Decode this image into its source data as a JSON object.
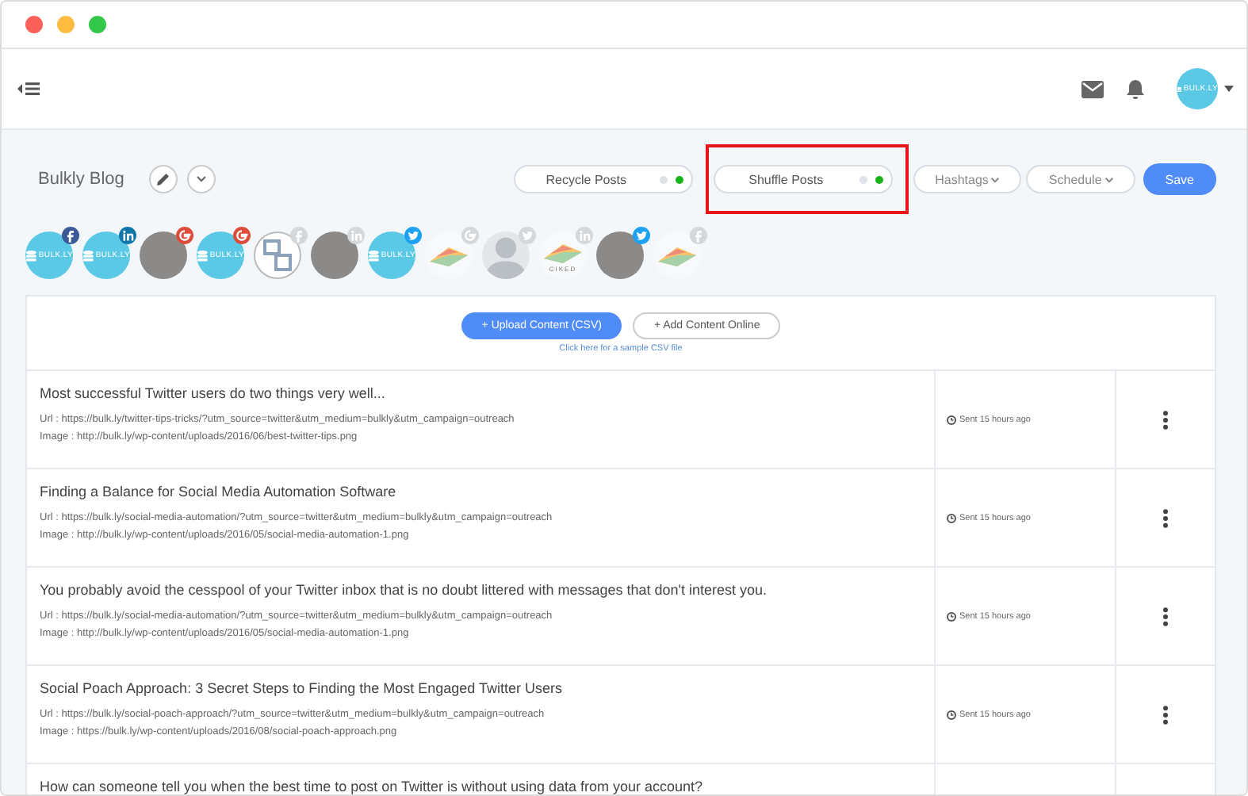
{
  "header": {
    "avatar_label": "BULK.LY"
  },
  "blog": {
    "title": "Bulkly Blog"
  },
  "toggles": [
    {
      "label": "Recycle Posts",
      "on": true,
      "highlighted": false
    },
    {
      "label": "Shuffle Posts",
      "on": true,
      "highlighted": true
    }
  ],
  "dropdowns": [
    "Hashtags",
    "Schedule"
  ],
  "save_button": "Save",
  "accounts": [
    {
      "kind": "logo",
      "text": "BULK.LY",
      "badge": {
        "kind": "facebook",
        "color": "#3b5998"
      }
    },
    {
      "kind": "logo",
      "text": "BULK.LY",
      "badge": {
        "kind": "linkedin",
        "color": "#0e76a8"
      }
    },
    {
      "kind": "photo",
      "badge": {
        "kind": "google",
        "color": "#dd4b39"
      }
    },
    {
      "kind": "logo",
      "text": "BULK.LY",
      "badge": {
        "kind": "google",
        "color": "#dd4b39"
      }
    },
    {
      "kind": "monogram",
      "badge": {
        "kind": "facebook",
        "color": "#d5d8db"
      }
    },
    {
      "kind": "photo",
      "badge": {
        "kind": "linkedin",
        "color": "#d5d8db"
      }
    },
    {
      "kind": "logo",
      "text": "BULK.LY",
      "badge": {
        "kind": "twitter",
        "color": "#1da1f2"
      }
    },
    {
      "kind": "artwork",
      "badge": {
        "kind": "google",
        "color": "#d5d8db"
      }
    },
    {
      "kind": "person",
      "badge": {
        "kind": "twitter",
        "color": "#d5d8db"
      }
    },
    {
      "kind": "artwork",
      "text": "CIKED",
      "badge": {
        "kind": "linkedin",
        "color": "#d5d8db"
      }
    },
    {
      "kind": "photo",
      "badge": {
        "kind": "twitter",
        "color": "#1da1f2"
      }
    },
    {
      "kind": "artwork",
      "badge": {
        "kind": "facebook",
        "color": "#d5d8db"
      }
    }
  ],
  "upload": {
    "primary": "+ Upload Content (CSV)",
    "secondary": "+ Add Content Online",
    "sample_link": "Click here for a sample CSV file"
  },
  "posts": [
    {
      "title": "Most successful Twitter users do two things very well...",
      "url": "Url : https://bulk.ly/twitter-tips-tricks/?utm_source=twitter&utm_medium=bulkly&utm_campaign=outreach",
      "image": "Image : http://bulk.ly/wp-content/uploads/2016/06/best-twitter-tips.png",
      "time": "Sent 15 hours ago"
    },
    {
      "title": "Finding a Balance for Social Media Automation Software",
      "url": "Url : https://bulk.ly/social-media-automation/?utm_source=twitter&utm_medium=bulkly&utm_campaign=outreach",
      "image": "Image : http://bulk.ly/wp-content/uploads/2016/05/social-media-automation-1.png",
      "time": "Sent 15 hours ago"
    },
    {
      "title": "You probably avoid the cesspool of your Twitter inbox that is no doubt littered with messages that don't interest you.",
      "url": "Url : https://bulk.ly/social-media-automation/?utm_source=twitter&utm_medium=bulkly&utm_campaign=outreach",
      "image": "Image : http://bulk.ly/wp-content/uploads/2016/05/social-media-automation-1.png",
      "time": "Sent 15 hours ago"
    },
    {
      "title": "Social Poach Approach: 3 Secret Steps to Finding the Most Engaged Twitter Users",
      "url": "Url : https://bulk.ly/social-poach-approach/?utm_source=twitter&utm_medium=bulkly&utm_campaign=outreach",
      "image": "Image : https://bulk.ly/wp-content/uploads/2016/08/social-poach-approach.png",
      "time": "Sent 15 hours ago"
    },
    {
      "title": "How can someone tell you when the best time to post on Twitter is without using data from your account?"
    }
  ]
}
